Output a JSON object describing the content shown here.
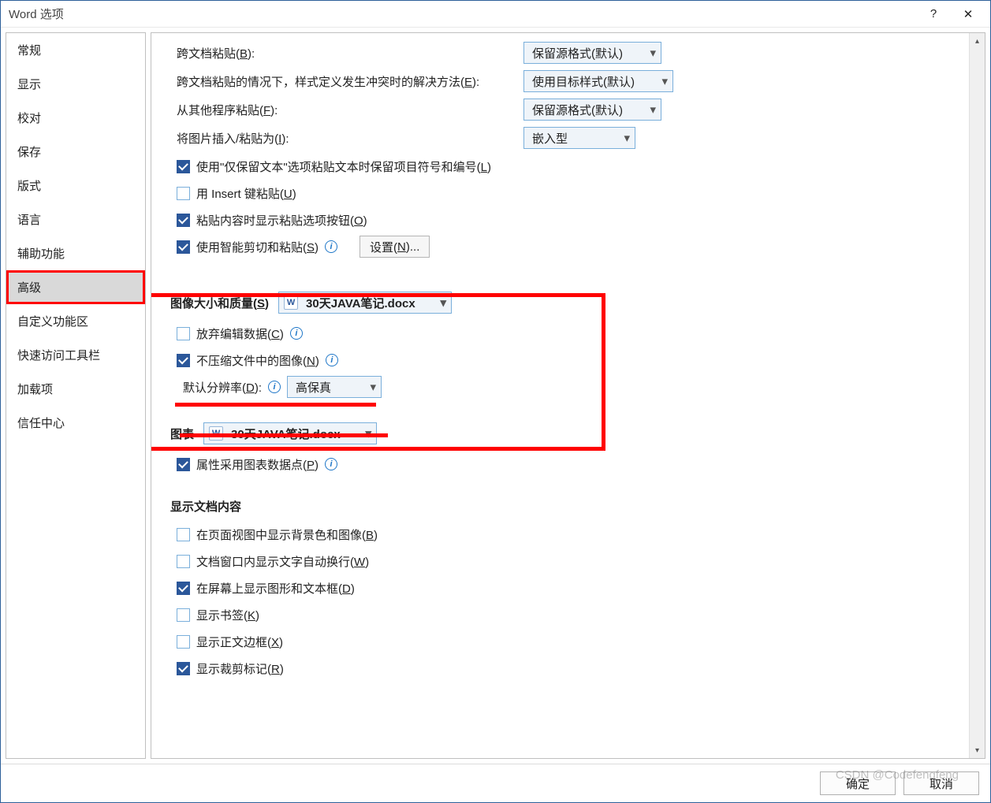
{
  "window": {
    "title": "Word 选项",
    "help": "?",
    "close": "✕"
  },
  "sidebar": {
    "items": [
      {
        "label": "常规"
      },
      {
        "label": "显示"
      },
      {
        "label": "校对"
      },
      {
        "label": "保存"
      },
      {
        "label": "版式"
      },
      {
        "label": "语言"
      },
      {
        "label": "辅助功能"
      },
      {
        "label": "高级"
      },
      {
        "label": "自定义功能区"
      },
      {
        "label": "快速访问工具栏"
      },
      {
        "label": "加载项"
      },
      {
        "label": "信任中心"
      }
    ]
  },
  "paste": {
    "cross_doc_label": "跨文档粘贴(",
    "cross_doc_key": "B",
    "cross_doc_suffix": "):",
    "cross_doc_value": "保留源格式(默认)",
    "cross_doc_styleconflict_label": "跨文档粘贴的情况下，样式定义发生冲突时的解决方法(",
    "cross_doc_styleconflict_key": "E",
    "cross_doc_styleconflict_suffix": "):",
    "cross_doc_styleconflict_value": "使用目标样式(默认)",
    "other_prog_label": "从其他程序粘贴(",
    "other_prog_key": "F",
    "other_prog_suffix": "):",
    "other_prog_value": "保留源格式(默认)",
    "insert_pic_label": "将图片插入/粘贴为(",
    "insert_pic_key": "I",
    "insert_pic_suffix": "):",
    "insert_pic_value": "嵌入型",
    "chk1_pre": "使用\"仅保留文本\"选项粘贴文本时保留项目符号和编号(",
    "chk1_key": "L",
    "chk1_suf": ")",
    "chk2_pre": "用 Insert 键粘贴(",
    "chk2_key": "U",
    "chk2_suf": ")",
    "chk3_pre": "粘贴内容时显示粘贴选项按钮(",
    "chk3_key": "O",
    "chk3_suf": ")",
    "chk4_pre": "使用智能剪切和粘贴(",
    "chk4_key": "S",
    "chk4_suf": ")",
    "settings_btn_pre": "设置(",
    "settings_btn_key": "N",
    "settings_btn_suf": ")..."
  },
  "image": {
    "section_pre": "图像大小和质量(",
    "section_key": "S",
    "section_suf": ")",
    "doc_name": "30天JAVA笔记.docx",
    "discard_pre": "放弃编辑数据(",
    "discard_key": "C",
    "discard_suf": ")",
    "nocompress_pre": "不压缩文件中的图像(",
    "nocompress_key": "N",
    "nocompress_suf": ")",
    "defaultres_pre": "默认分辨率(",
    "defaultres_key": "D",
    "defaultres_suf": "):",
    "defaultres_value": "高保真"
  },
  "chart": {
    "section": "图表",
    "doc_name": "30天JAVA笔记.docx",
    "prop_pre": "属性采用图表数据点(",
    "prop_key": "P",
    "prop_suf": ")"
  },
  "display": {
    "section": "显示文档内容",
    "bg_pre": "在页面视图中显示背景色和图像(",
    "bg_key": "B",
    "bg_suf": ")",
    "wrap_pre": "文档窗口内显示文字自动换行(",
    "wrap_key": "W",
    "wrap_suf": ")",
    "shapes_pre": "在屏幕上显示图形和文本框(",
    "shapes_key": "D",
    "shapes_suf": ")",
    "bookmark_pre": "显示书签(",
    "bookmark_key": "K",
    "bookmark_suf": ")",
    "border_pre": "显示正文边框(",
    "border_key": "X",
    "border_suf": ")",
    "crop_pre": "显示裁剪标记(",
    "crop_key": "R",
    "crop_suf": ")"
  },
  "footer": {
    "ok": "确定",
    "cancel": "取消"
  },
  "watermark": "CSDN @Codefengfeng"
}
